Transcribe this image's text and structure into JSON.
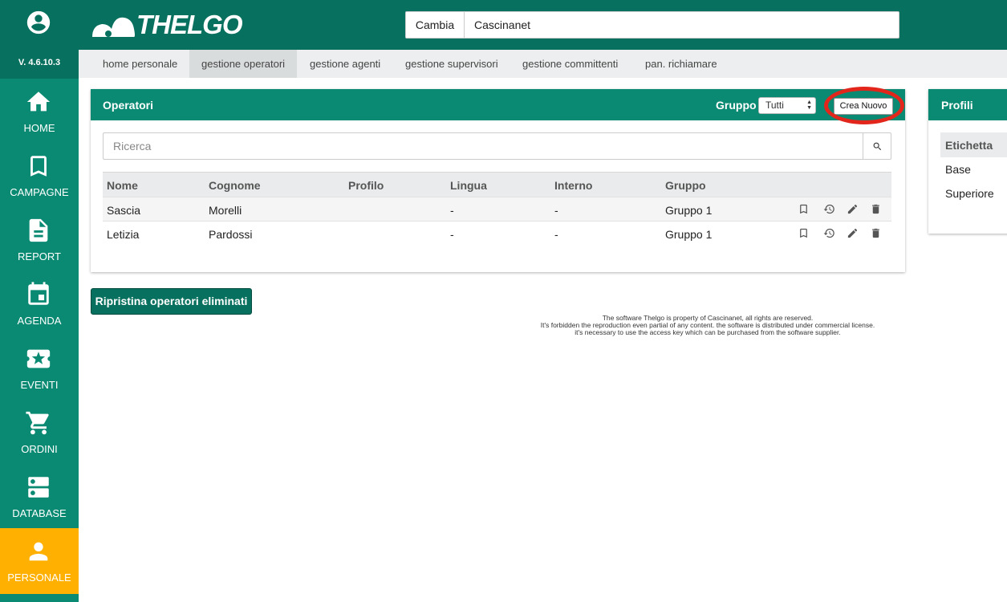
{
  "app": {
    "brand": "THELGO",
    "version": "V. 4.6.10.3"
  },
  "sidebar": {
    "items": [
      {
        "label": "HOME",
        "icon": "home-icon"
      },
      {
        "label": "CAMPAGNE",
        "icon": "bookmark-icon"
      },
      {
        "label": "REPORT",
        "icon": "document-icon"
      },
      {
        "label": "AGENDA",
        "icon": "calendar-icon"
      },
      {
        "label": "EVENTI",
        "icon": "ticket-star-icon"
      },
      {
        "label": "ORDINI",
        "icon": "cart-icon"
      },
      {
        "label": "DATABASE",
        "icon": "database-icon"
      },
      {
        "label": "PERSONALE",
        "icon": "person-icon",
        "active": true
      }
    ],
    "colors": {
      "background": "#0b8a73",
      "active": "#ffb000"
    }
  },
  "header": {
    "switch_label": "Cambia",
    "company": "Cascinanet"
  },
  "tabs": [
    {
      "label": "home personale"
    },
    {
      "label": "gestione operatori",
      "active": true
    },
    {
      "label": "gestione agenti"
    },
    {
      "label": "gestione supervisori"
    },
    {
      "label": "gestione committenti"
    },
    {
      "label": "pan. richiamare"
    }
  ],
  "operatori": {
    "title": "Operatori",
    "gruppo_label": "Gruppo",
    "gruppo_selected": "Tutti",
    "create_label": "Crea Nuovo",
    "search_placeholder": "Ricerca",
    "columns": [
      "Nome",
      "Cognome",
      "Profilo",
      "Lingua",
      "Interno",
      "Gruppo"
    ],
    "rows": [
      {
        "nome": "Sascia",
        "cognome": "Morelli",
        "profilo": "",
        "lingua": "-",
        "interno": "-",
        "gruppo": "Gruppo 1"
      },
      {
        "nome": "Letizia",
        "cognome": "Pardossi",
        "profilo": "",
        "lingua": "-",
        "interno": "-",
        "gruppo": "Gruppo 1"
      }
    ],
    "row_actions": [
      "bookmark-icon",
      "history-icon",
      "edit-icon",
      "trash-icon"
    ]
  },
  "restore_label": "Ripristina operatori eliminati",
  "footer": {
    "line1": "The software Thelgo is property of Cascinanet, all rights are reserved.",
    "line2": "It's forbidden the reproduction even partial of any content. the software is distributed under commercial license.",
    "line3": "it's necessary to use the access key which can be purchased from the software supplier."
  },
  "profili": {
    "title": "Profili",
    "column": "Etichetta",
    "rows": [
      "Base",
      "Superiore"
    ]
  },
  "colors": {
    "header": "#07705e",
    "accent": "#0b8a73",
    "highlight": "#e3261c"
  }
}
